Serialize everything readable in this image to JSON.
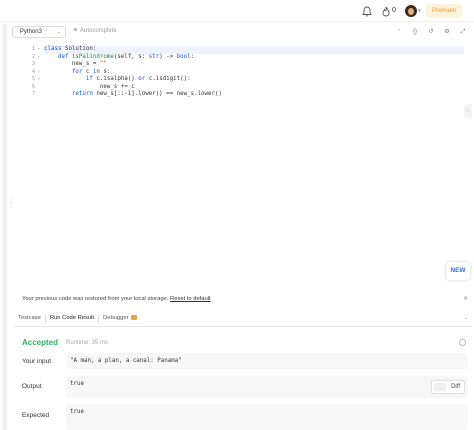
{
  "topbar": {
    "icons": [
      "bell-icon",
      "fire-icon"
    ],
    "streak_count": "0",
    "premium_label": "Premium",
    "premium_color": "#e89a1c"
  },
  "editor": {
    "language": "Python3",
    "autocomplete_label": "Autocomplete",
    "line_numbers": [
      "1",
      "2",
      "3",
      "4",
      "5",
      "6",
      "7"
    ],
    "new_badge": "NEW"
  },
  "restore_bar": {
    "message": "Your previous code was restored from your local storage.",
    "link": "Reset to default"
  },
  "tabs": [
    "Testcase",
    "Run Code Result",
    "Debugger"
  ],
  "result": {
    "status": "Accepted",
    "status_color": "#2db55d",
    "runtime": "Runtime: 35 ms",
    "input_label": "Your input",
    "input_value": "\"A man, a plan, a canal: Panama\"",
    "output_label": "Output",
    "output_value": "true",
    "diff_label": "Diff",
    "expected_label": "Expected",
    "expected_value": "true"
  }
}
